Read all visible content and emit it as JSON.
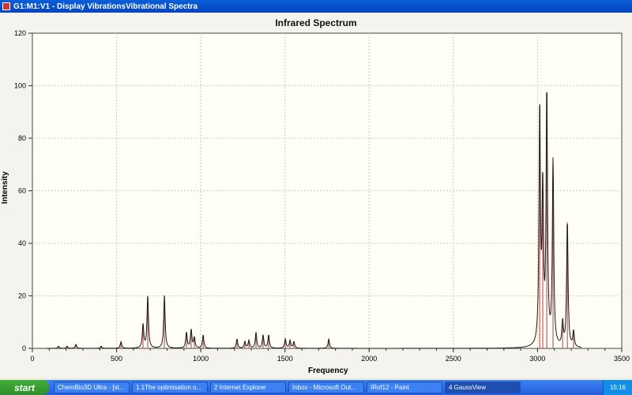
{
  "window": {
    "title": "G1:M1:V1 - Display VibrationsVibrational Spectra"
  },
  "chart_data": {
    "type": "line",
    "title": "Infrared Spectrum",
    "xlabel": "Frequency",
    "ylabel": "Intensity",
    "xlim": [
      0,
      3500
    ],
    "ylim": [
      0,
      120
    ],
    "xticks": [
      0,
      500,
      1000,
      1500,
      2000,
      2500,
      3000,
      3500
    ],
    "yticks": [
      0,
      20,
      40,
      60,
      80,
      100,
      120
    ],
    "grid": true,
    "sticks": {
      "x": [
        155,
        206,
        258,
        408,
        526,
        657,
        685,
        784,
        915,
        943,
        962,
        1014,
        1215,
        1262,
        1286,
        1328,
        1370,
        1403,
        1502,
        1530,
        1553,
        1760,
        3013,
        3031,
        3055,
        3092,
        3149,
        3177,
        3214
      ],
      "y": [
        0.8,
        0.8,
        1.5,
        0.8,
        2.5,
        9,
        20,
        20,
        6,
        7,
        4,
        5,
        3.5,
        2.5,
        3,
        6,
        5,
        5,
        3.5,
        3,
        2.5,
        3.5,
        90,
        58,
        96,
        70,
        9,
        48,
        6
      ]
    },
    "colors": {
      "curve": "#1a1a1a",
      "sticks": "#c46a6a"
    }
  },
  "taskbar": {
    "start": "start",
    "items": [
      "ChemBio3D Ultra - [st...",
      "1.1The optimisation o...",
      "2 Internet Explorer",
      "Inbox - Microsoft Out...",
      "IRof12 - Paint",
      "4 GaussView"
    ],
    "clock": "15:16"
  }
}
